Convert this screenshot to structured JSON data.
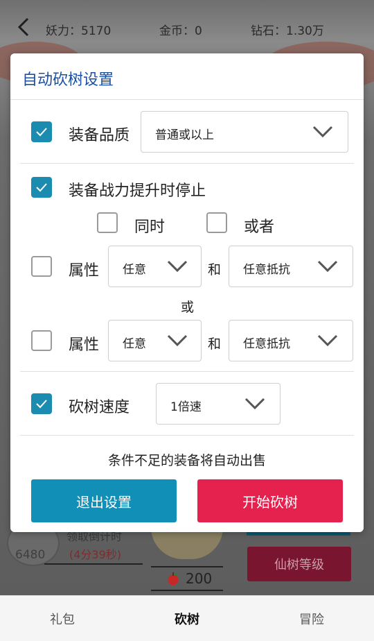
{
  "header": {
    "power_label": "妖力：5170",
    "gold_label": "金币：0",
    "diamond_label": "钻石：1.30万"
  },
  "background": {
    "badge_value": "6480",
    "countdown_label": "领取倒计时",
    "countdown_time": "(4分39秒)",
    "apple_count": "200",
    "tree_level_button": "仙树等级"
  },
  "dialog": {
    "title": "自动砍树设置",
    "quality": {
      "checked": true,
      "label": "装备品质",
      "selected": "普通或以上"
    },
    "stop_on_power_up": {
      "checked": true,
      "label": "装备战力提升时停止"
    },
    "logic": {
      "and_label": "同时",
      "and_checked": false,
      "or_label": "或者",
      "or_checked": false
    },
    "attribute_rows": [
      {
        "checked": false,
        "label": "属性",
        "first": "任意",
        "joiner": "和",
        "second": "任意抵抗"
      },
      {
        "checked": false,
        "label": "属性",
        "first": "任意",
        "joiner": "和",
        "second": "任意抵抗"
      }
    ],
    "or_separator": "或",
    "speed": {
      "checked": true,
      "label": "砍树速度",
      "selected": "1倍速"
    },
    "hint": "条件不足的装备将自动出售",
    "exit_button": "退出设置",
    "start_button": "开始砍树"
  },
  "bottom_nav": {
    "items": [
      {
        "label": "礼包",
        "active": false
      },
      {
        "label": "砍树",
        "active": true
      },
      {
        "label": "冒险",
        "active": false
      }
    ]
  },
  "colors": {
    "accent_blue": "#118fb6",
    "checkbox_blue": "#1b8cb0",
    "start_red": "#e5214e",
    "title_blue": "#1a4fa0"
  },
  "icons": [
    "back-arrow-icon",
    "check-icon",
    "chevron-down-icon",
    "apple-icon"
  ]
}
